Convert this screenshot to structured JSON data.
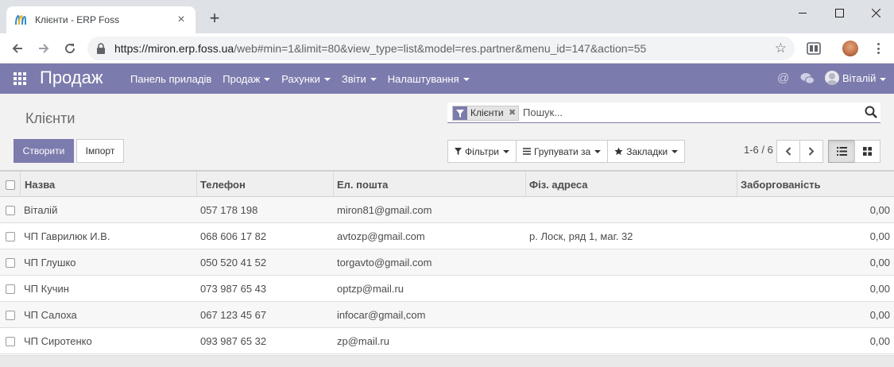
{
  "browser": {
    "tab_title": "Клієнти - ERP Foss",
    "tab_close": "×",
    "new_tab": "+",
    "url_host": "https://miron.erp.foss.ua",
    "url_rest": "/web#min=1&limit=80&view_type=list&model=res.partner&menu_id=147&action=55",
    "star": "☆"
  },
  "navbar": {
    "brand": "Продаж",
    "menu": [
      {
        "label": "Панель приладів",
        "dropdown": false
      },
      {
        "label": "Продаж",
        "dropdown": true
      },
      {
        "label": "Рахунки",
        "dropdown": true
      },
      {
        "label": "Звіти",
        "dropdown": true
      },
      {
        "label": "Налаштування",
        "dropdown": true
      }
    ],
    "at": "@",
    "user": "Віталій",
    "accent": "#7c7bad"
  },
  "control": {
    "title": "Клієнти",
    "facet_label": "Клієнти",
    "facet_remove": "✖",
    "search_placeholder": "Пошук...",
    "create": "Створити",
    "import": "Імпорт",
    "filters": "Фільтри",
    "group_by": "Групувати за",
    "favorites": "Закладки",
    "pager": "1-6 / 6"
  },
  "table": {
    "columns": [
      "Назва",
      "Телефон",
      "Ел. пошта",
      "Фіз. адреса",
      "Заборгованість"
    ],
    "rows": [
      {
        "name": "Віталій",
        "phone": "057 178 198",
        "email": "miron81@gmail.com",
        "address": "",
        "debt": "0,00"
      },
      {
        "name": "ЧП Гаврилюк И.В.",
        "phone": "068 606 17 82",
        "email": "avtozp@gmail.com",
        "address": "р. Лоск, ряд 1, маг. 32",
        "debt": "0,00"
      },
      {
        "name": "ЧП Глушко",
        "phone": "050 520 41 52",
        "email": "torgavto@gmail.com",
        "address": "",
        "debt": "0,00"
      },
      {
        "name": "ЧП Кучин",
        "phone": "073 987 65 43",
        "email": "optzp@mail.ru",
        "address": "",
        "debt": "0,00"
      },
      {
        "name": "ЧП Салоха",
        "phone": "067 123 45 67",
        "email": "infocar@gmail,com",
        "address": "",
        "debt": "0,00"
      },
      {
        "name": "ЧП Сиротенко",
        "phone": "093 987 65 32",
        "email": "zp@mail.ru",
        "address": "",
        "debt": "0,00"
      }
    ]
  }
}
